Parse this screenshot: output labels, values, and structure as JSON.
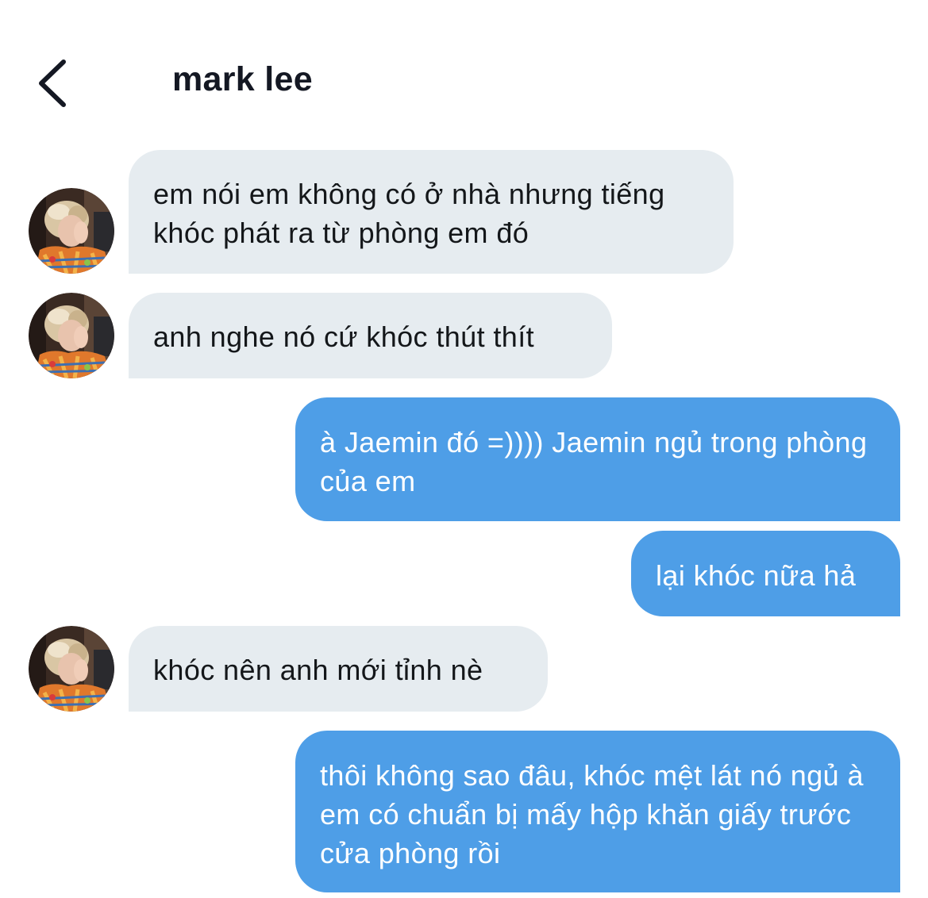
{
  "header": {
    "title": "mark lee",
    "back_icon": "chevron-left-icon"
  },
  "colors": {
    "incoming_bubble": "#e6ecf0",
    "outgoing_bubble": "#4e9ee7",
    "incoming_text": "#14171a",
    "outgoing_text": "#ffffff"
  },
  "messages": [
    {
      "direction": "incoming",
      "text": "em nói em không có ở nhà nhưng tiếng khóc phát ra từ phòng em đó"
    },
    {
      "direction": "incoming",
      "text": "anh nghe nó cứ khóc thút thít"
    },
    {
      "direction": "outgoing",
      "text": "à Jaemin đó =)))) Jaemin ngủ trong phòng của em"
    },
    {
      "direction": "outgoing",
      "text": "lại khóc nữa hả"
    },
    {
      "direction": "incoming",
      "text": "khóc nên anh mới tỉnh nè"
    },
    {
      "direction": "outgoing",
      "text": "thôi không sao đâu, khóc mệt lát nó ngủ à em có chuẩn bị mấy hộp khăn giấy trước cửa phòng rồi"
    }
  ]
}
